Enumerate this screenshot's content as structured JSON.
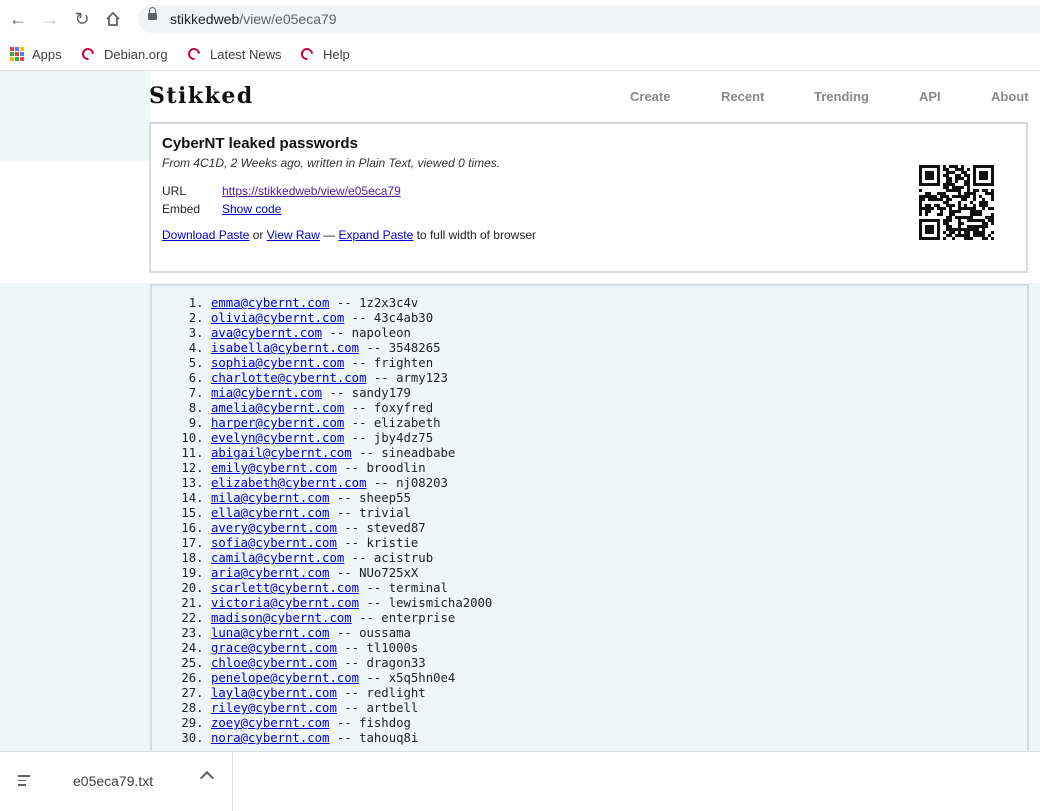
{
  "browser": {
    "url_host": "stikkedweb",
    "url_path": "/view/e05eca79",
    "bookmarks": [
      {
        "label": "Apps",
        "icon": "apps-grid-icon"
      },
      {
        "label": "Debian.org",
        "icon": "debian-swirl-icon"
      },
      {
        "label": "Latest News",
        "icon": "debian-swirl-icon"
      },
      {
        "label": "Help",
        "icon": "debian-swirl-icon"
      }
    ]
  },
  "site": {
    "logo": "Stikked",
    "nav": [
      "Create",
      "Recent",
      "Trending",
      "API",
      "About"
    ]
  },
  "paste": {
    "title": "CyberNT leaked passwords",
    "meta": "From 4C1D, 2 Weeks ago, written in Plain Text, viewed 0 times.",
    "url_label": "URL",
    "url_value": "https://stikkedweb/view/e05eca79",
    "embed_label": "Embed",
    "embed_link": "Show code",
    "download": "Download Paste",
    "or": " or ",
    "view_raw": "View Raw",
    "dash": " — ",
    "expand": "Expand Paste",
    "suffix": " to full width of browser",
    "lines": [
      {
        "email": "emma@cybernt.com",
        "pw": " -- 1z2x3c4v"
      },
      {
        "email": "olivia@cybernt.com",
        "pw": " -- 43c4ab30"
      },
      {
        "email": "ava@cybernt.com",
        "pw": " -- napoleon"
      },
      {
        "email": "isabella@cybernt.com",
        "pw": " -- 3548265"
      },
      {
        "email": "sophia@cybernt.com",
        "pw": " -- frighten"
      },
      {
        "email": "charlotte@cybernt.com",
        "pw": " -- army123"
      },
      {
        "email": "mia@cybernt.com",
        "pw": " -- sandy179"
      },
      {
        "email": "amelia@cybernt.com",
        "pw": " -- foxyfred"
      },
      {
        "email": "harper@cybernt.com",
        "pw": " -- elizabeth"
      },
      {
        "email": "evelyn@cybernt.com",
        "pw": " -- jby4dz75"
      },
      {
        "email": "abigail@cybernt.com",
        "pw": " -- sineadbabe"
      },
      {
        "email": "emily@cybernt.com",
        "pw": " -- broodlin"
      },
      {
        "email": "elizabeth@cybernt.com",
        "pw": " -- nj08203"
      },
      {
        "email": "mila@cybernt.com",
        "pw": " -- sheep55"
      },
      {
        "email": "ella@cybernt.com",
        "pw": " -- trivial"
      },
      {
        "email": "avery@cybernt.com",
        "pw": " -- steved87"
      },
      {
        "email": "sofia@cybernt.com",
        "pw": " -- kristie"
      },
      {
        "email": "camila@cybernt.com",
        "pw": " -- acistrub"
      },
      {
        "email": "aria@cybernt.com",
        "pw": " -- NUo725xX"
      },
      {
        "email": "scarlett@cybernt.com",
        "pw": " -- terminal"
      },
      {
        "email": "victoria@cybernt.com",
        "pw": " -- lewismicha2000"
      },
      {
        "email": "madison@cybernt.com",
        "pw": " -- enterprise"
      },
      {
        "email": "luna@cybernt.com",
        "pw": " -- oussama"
      },
      {
        "email": "grace@cybernt.com",
        "pw": " -- tl1000s"
      },
      {
        "email": "chloe@cybernt.com",
        "pw": " -- dragon33"
      },
      {
        "email": "penelope@cybernt.com",
        "pw": " -- x5q5hn0e4"
      },
      {
        "email": "layla@cybernt.com",
        "pw": " -- redlight"
      },
      {
        "email": "riley@cybernt.com",
        "pw": " -- artbell"
      },
      {
        "email": "zoey@cybernt.com",
        "pw": " -- fishdog"
      },
      {
        "email": "nora@cybernt.com",
        "pw": " -- tahouq8i"
      }
    ]
  },
  "download_bar": {
    "filename": "e05eca79.txt"
  },
  "colors": {
    "link": "#0000cc",
    "band": "#eef6f8",
    "border": "#d6dbe0",
    "debian_red": "#c70036"
  }
}
